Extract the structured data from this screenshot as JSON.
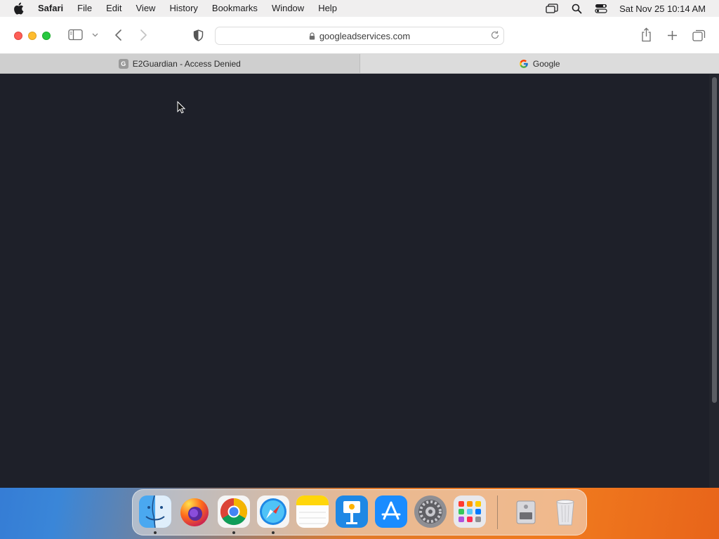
{
  "menubar": {
    "app_name": "Safari",
    "items": [
      "File",
      "Edit",
      "View",
      "History",
      "Bookmarks",
      "Window",
      "Help"
    ],
    "clock": "Sat Nov 25  10:14 AM",
    "status_icons": [
      "screen-mirroring-icon",
      "spotlight-search-icon",
      "control-center-icon"
    ]
  },
  "toolbar": {
    "address": "googleadservices.com"
  },
  "tabs": [
    {
      "title": "E2Guardian - Access Denied",
      "favicon": "G",
      "active": true
    },
    {
      "title": "Google",
      "favicon": "google-g-icon",
      "active": false
    }
  ],
  "dock": {
    "apps": [
      "Finder",
      "Firefox",
      "Google Chrome",
      "Safari",
      "Notes",
      "Keynote",
      "App Store",
      "System Preferences",
      "Launchpad",
      "Disk Utility",
      "Trash"
    ]
  },
  "colors": {
    "page_background": "#1e2029",
    "close": "#fe5f57",
    "minimize": "#febc2e",
    "maximize": "#28c840"
  }
}
